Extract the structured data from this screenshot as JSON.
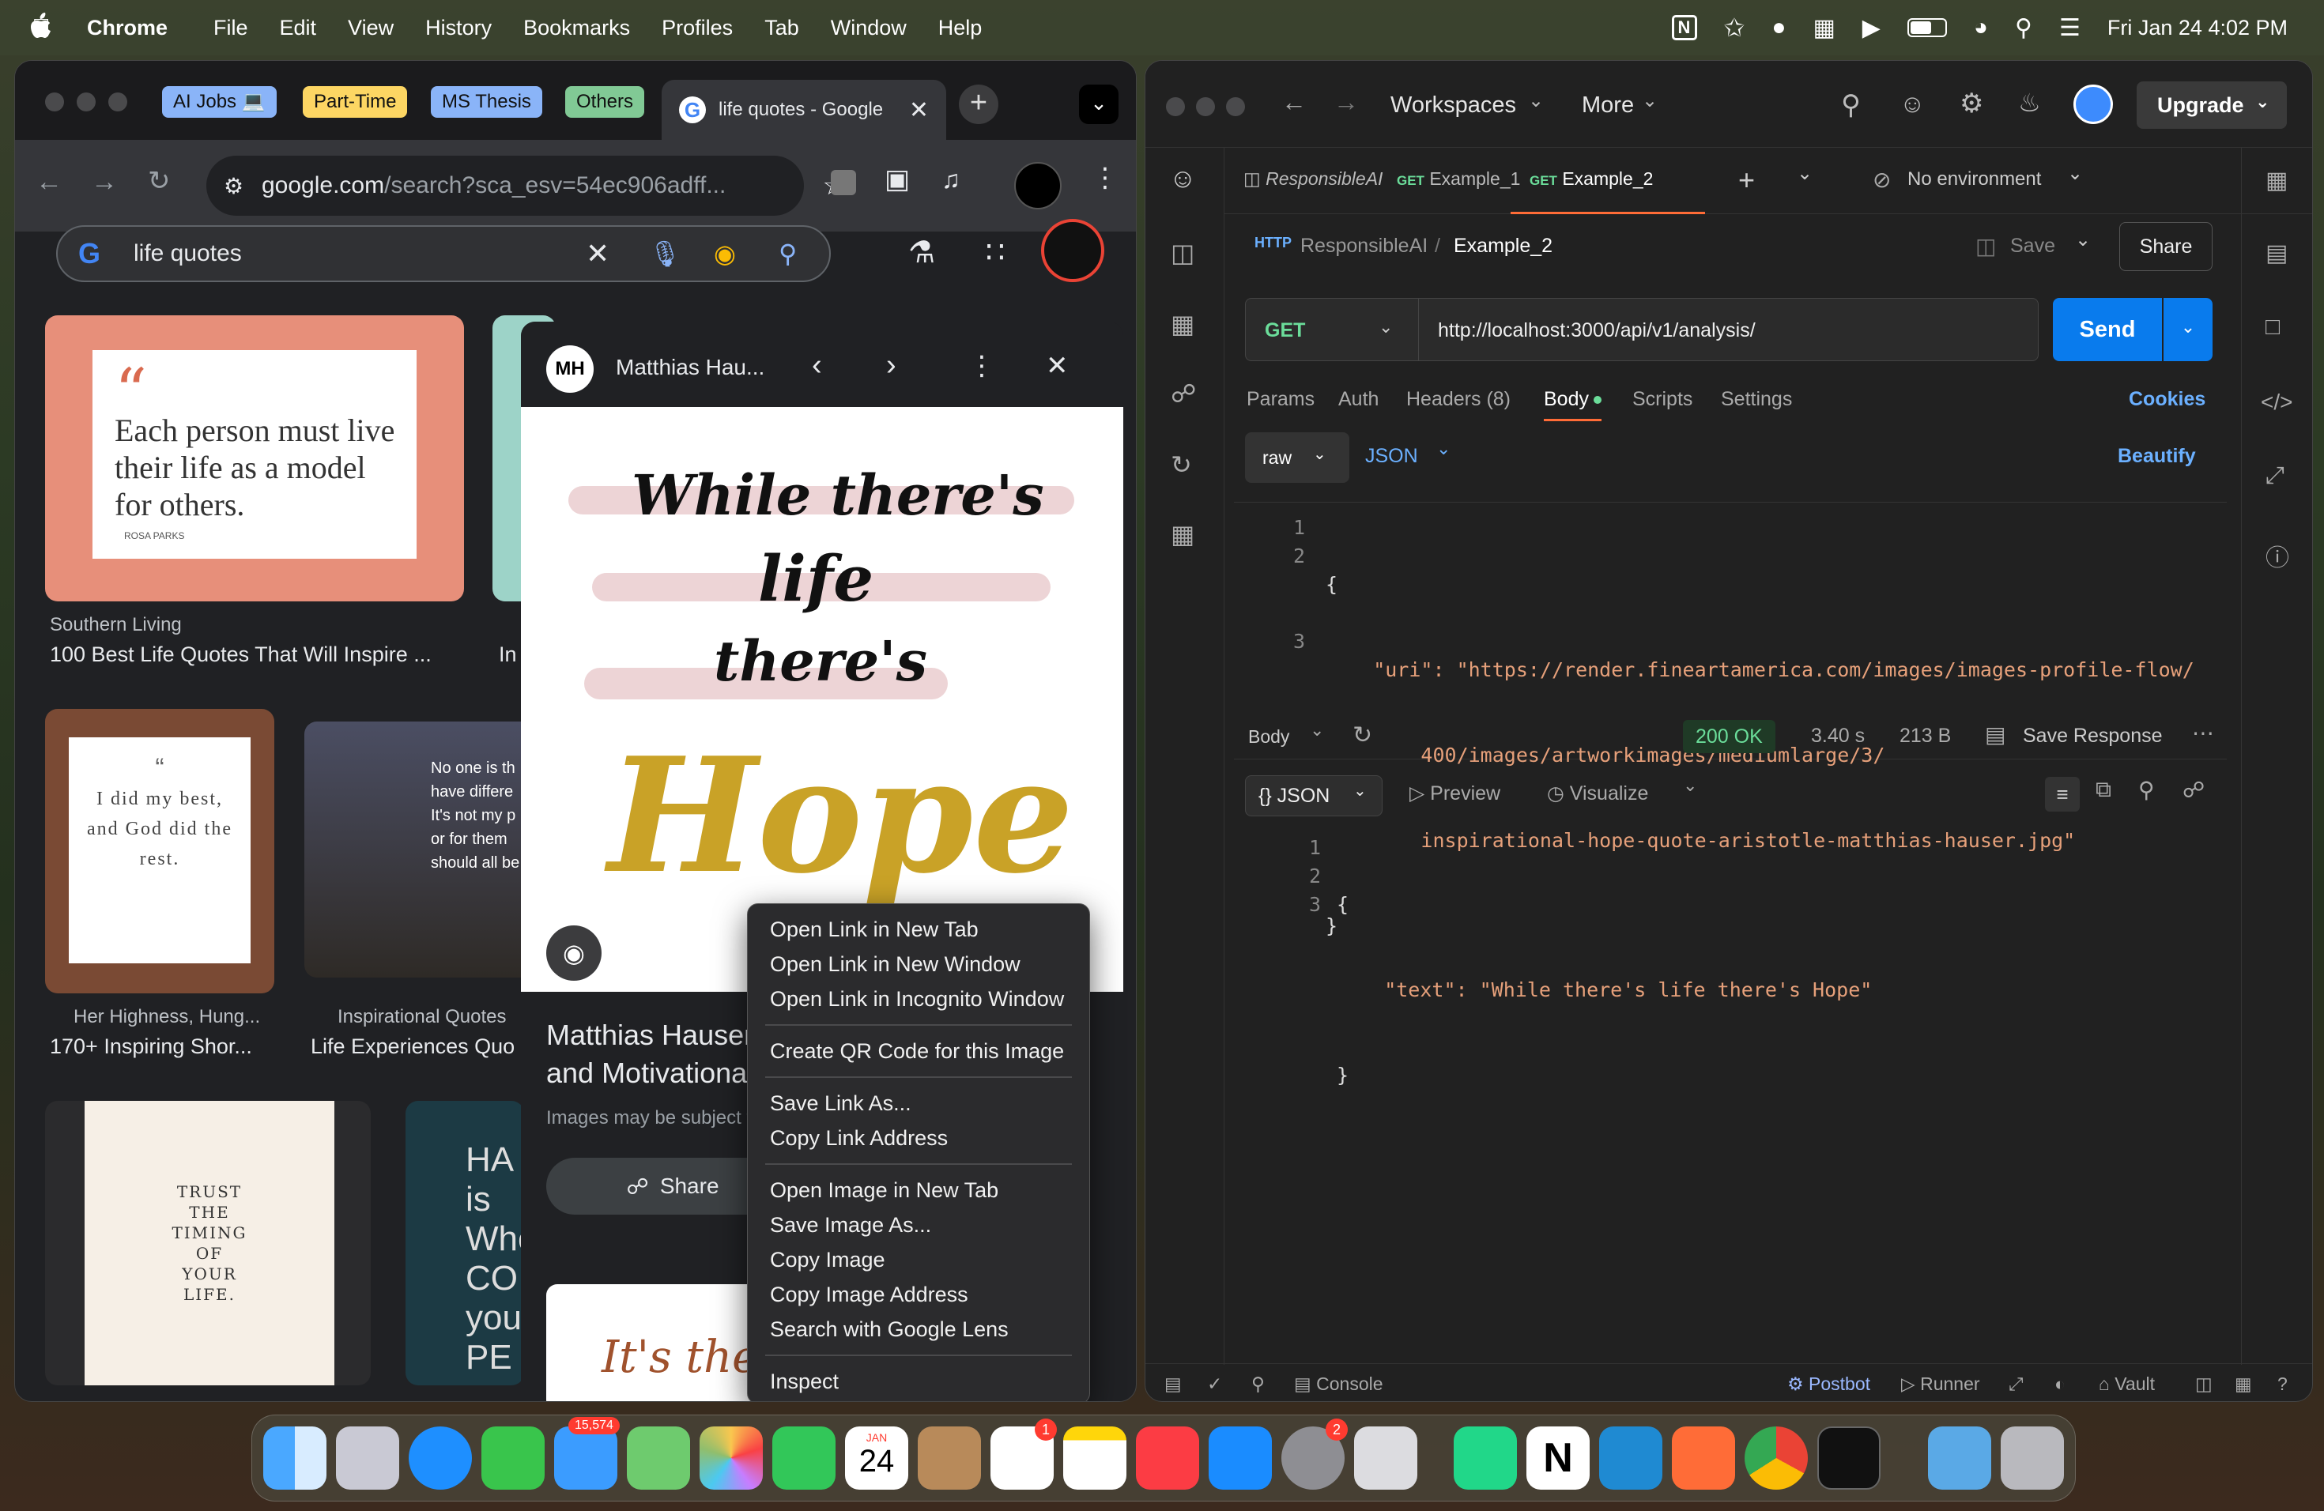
{
  "menubar": {
    "app": "Chrome",
    "items": [
      "File",
      "Edit",
      "View",
      "History",
      "Bookmarks",
      "Profiles",
      "Tab",
      "Window",
      "Help"
    ],
    "datetime": "Fri Jan 24  4:02 PM"
  },
  "chrome": {
    "tab_groups": [
      "AI Jobs 💻",
      "Part-Time",
      "MS Thesis",
      "Others"
    ],
    "active_tab": "life quotes - Google",
    "url_host": "google.com",
    "url_rest": "/search?sca_esv=54ec906adff...",
    "search_query": "life quotes",
    "results": [
      {
        "source": "Southern Living",
        "title": "100 Best Life Quotes That Will Inspire ...",
        "quote": "Each person must live their life as a model for others.",
        "author": "ROSA PARKS"
      },
      {
        "source": "Her Highness, Hung...",
        "title": "170+ Inspiring Shor...",
        "quote": "I did my best, and God did the rest."
      },
      {
        "source": "Inspirational Quotes",
        "title": "Life Experiences Quo",
        "quote": "No one is th have differe It's not my p or for them should all be"
      },
      {
        "quote": "TRUST THE TIMING OF YOUR LIFE."
      },
      {
        "quote": "HA is Whe CO you PE"
      }
    ],
    "preview": {
      "initials": "MH",
      "author": "Matthias Hau...",
      "image_text": [
        "While there's",
        "life",
        "there's",
        "Hope"
      ],
      "title_lines": [
        "Matthias Hauser",
        "and Motivationa"
      ],
      "subtitle": "Images may be subject t",
      "share": "Share",
      "next_image_text": "It's the"
    }
  },
  "context_menu": {
    "groups": [
      [
        "Open Link in New Tab",
        "Open Link in New Window",
        "Open Link in Incognito Window"
      ],
      [
        "Create QR Code for this Image"
      ],
      [
        "Save Link As...",
        "Copy Link Address"
      ],
      [
        "Open Image in New Tab",
        "Save Image As...",
        "Copy Image",
        "Copy Image Address",
        "Search with Google Lens"
      ],
      [
        "Inspect"
      ]
    ]
  },
  "postman": {
    "nav": {
      "workspaces": "Workspaces",
      "more": "More",
      "upgrade": "Upgrade"
    },
    "tabs": [
      {
        "method": "",
        "name": "ResponsibleAI"
      },
      {
        "method": "GET",
        "name": "Example_1"
      },
      {
        "method": "GET",
        "name": "Example_2"
      }
    ],
    "environment": "No environment",
    "breadcrumb": {
      "collection": "ResponsibleAI",
      "request": "Example_2",
      "save": "Save",
      "share": "Share"
    },
    "method": "GET",
    "url": "http://localhost:3000/api/v1/analysis/",
    "send": "Send",
    "req_tabs": [
      "Params",
      "Auth",
      "Headers (8)",
      "Body",
      "Scripts",
      "Settings"
    ],
    "cookies": "Cookies",
    "body_mode": "raw",
    "body_lang": "JSON",
    "beautify": "Beautify",
    "req_body": [
      "{",
      "    \"uri\": \"https://render.fineartamerica.com/images/images-profile-flow/",
      "        400/images/artworkimages/mediumlarge/3/",
      "        inspirational-hope-quote-aristotle-matthias-hauser.jpg\"",
      "}"
    ],
    "req_line_nums": [
      "1",
      "2",
      "",
      "",
      "3"
    ],
    "response": {
      "label": "Body",
      "status": "200 OK",
      "time": "3.40 s",
      "size": "213 B",
      "save": "Save Response",
      "format": "JSON",
      "preview": "Preview",
      "visualize": "Visualize",
      "lines": [
        "{",
        "    \"text\": \"While there's life there's Hope\"",
        "}"
      ],
      "nums": [
        "1",
        "2",
        "3"
      ]
    },
    "footer": {
      "console": "Console",
      "postbot": "Postbot",
      "runner": "Runner",
      "vault": "Vault"
    }
  },
  "dock": {
    "mail_badge": "15,574",
    "calendar_month": "JAN",
    "calendar_day": "24",
    "reminders_badge": "1",
    "settings_badge": "2"
  }
}
